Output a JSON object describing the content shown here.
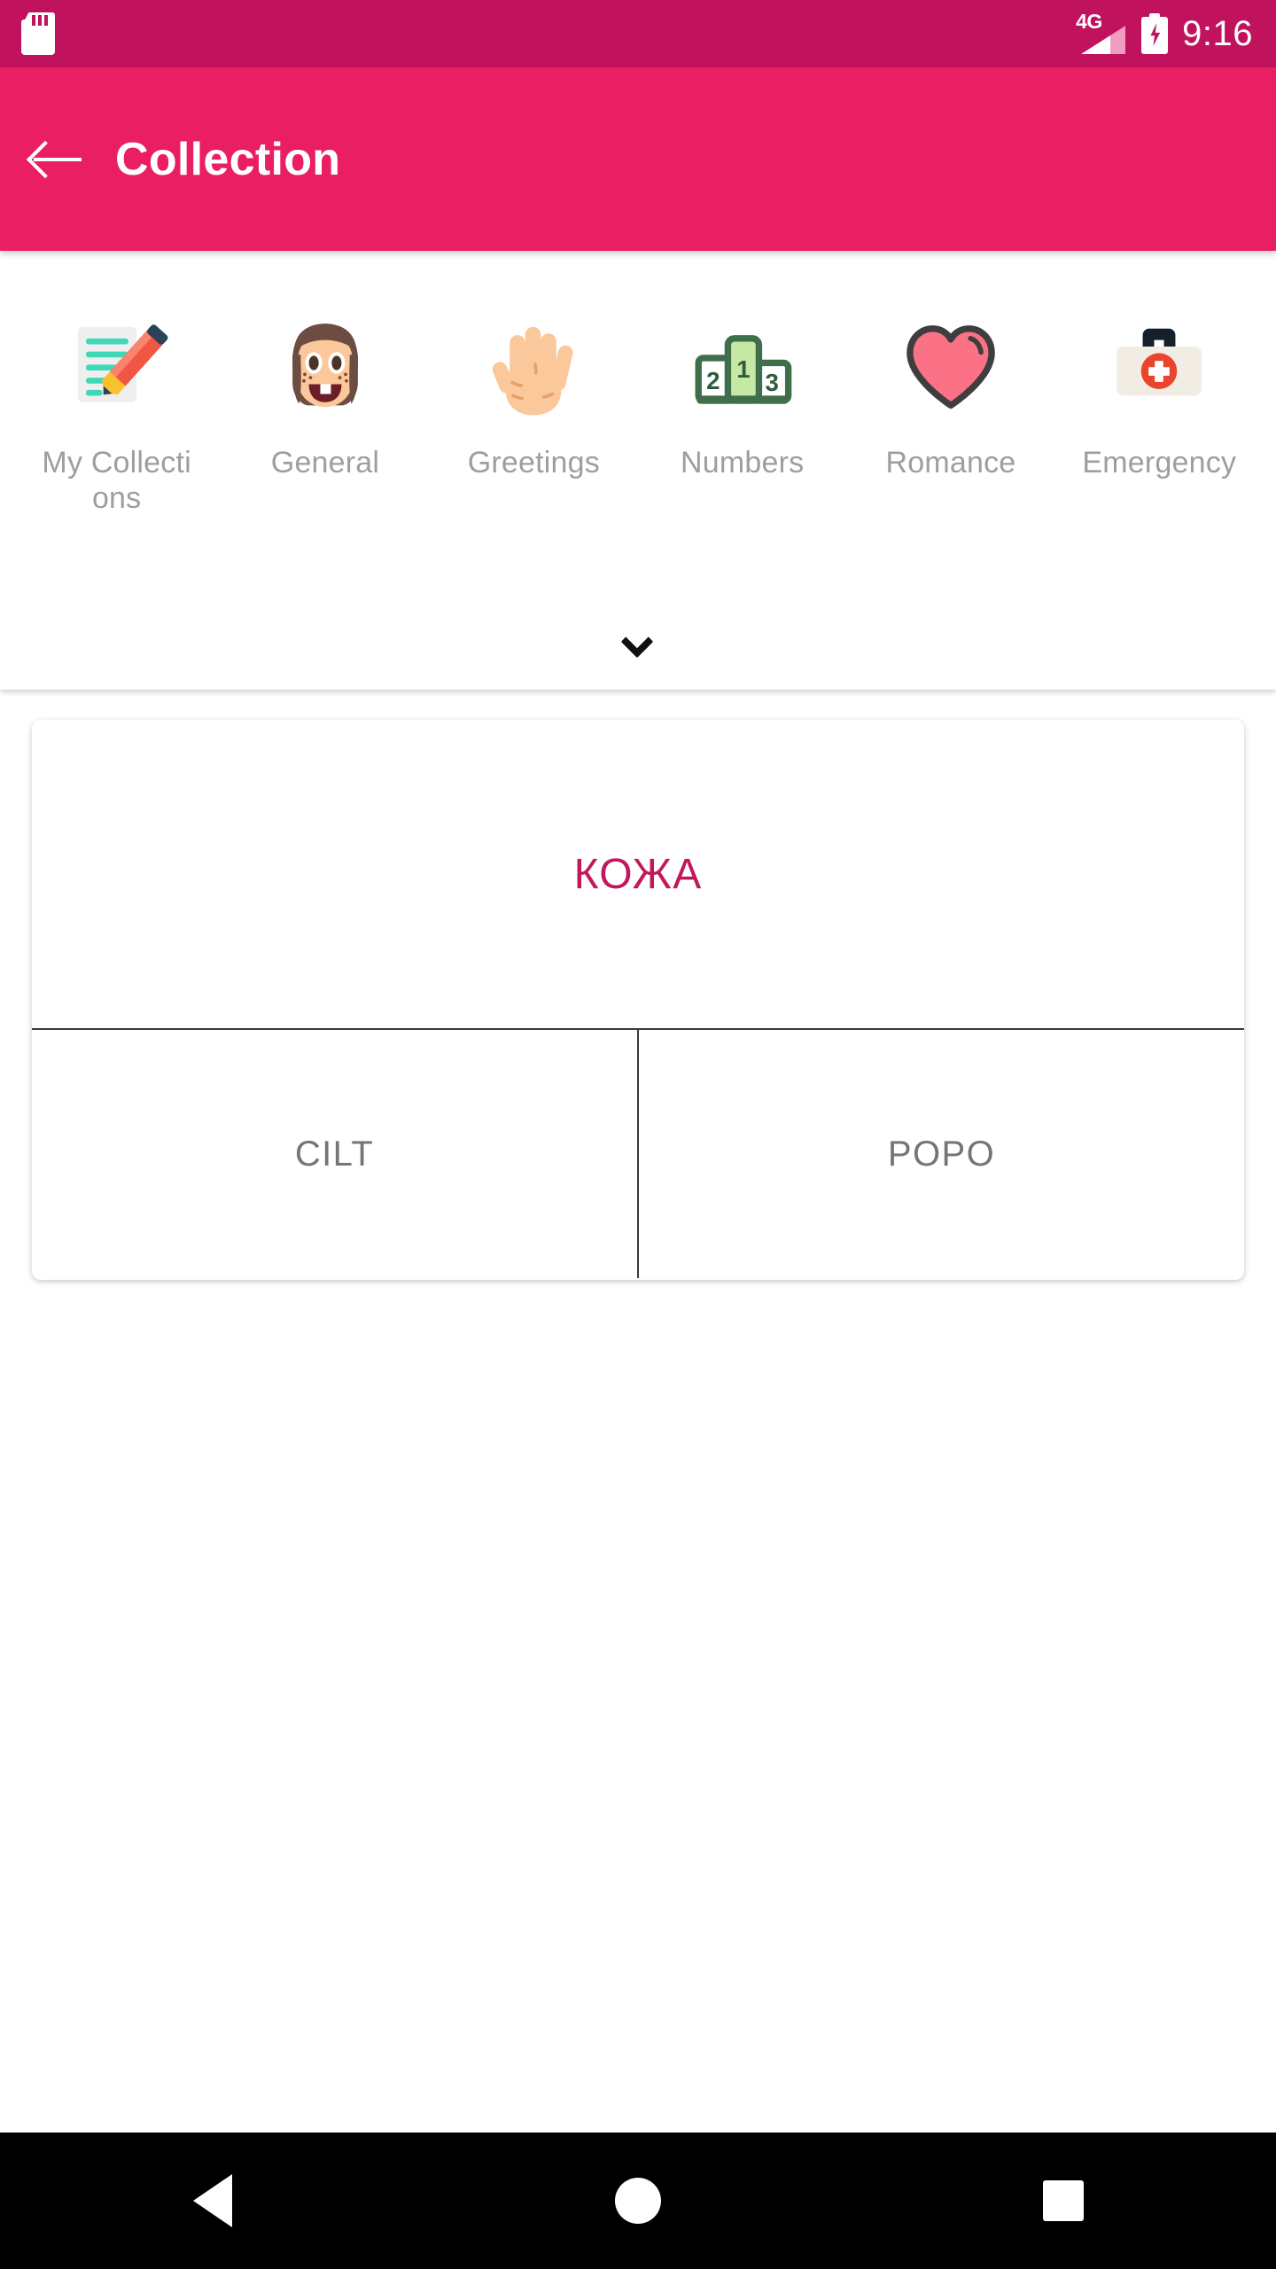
{
  "status_bar": {
    "sd_card_icon": "sd-card-icon",
    "network_type": "4G",
    "signal_icon": "signal-bars-icon",
    "battery_icon": "battery-charging-icon",
    "time": "9:16",
    "background_color": "#C0125D"
  },
  "app_bar": {
    "back_icon": "arrow-left-icon",
    "title": "Collection",
    "background_color": "#E91E63",
    "text_color": "#FFFFFF"
  },
  "categories": {
    "items": [
      {
        "label": "My Collections",
        "icon": "memo-pencil-icon"
      },
      {
        "label": "General",
        "icon": "girl-face-icon"
      },
      {
        "label": "Greetings",
        "icon": "raised-hand-icon"
      },
      {
        "label": "Numbers",
        "icon": "podium-icon"
      },
      {
        "label": "Romance",
        "icon": "heart-icon"
      },
      {
        "label": "Emergency",
        "icon": "first-aid-kit-icon"
      }
    ],
    "label_color": "#9E9E9E",
    "expand_icon": "chevron-down-icon"
  },
  "card": {
    "term": "КОЖА",
    "term_color": "#C2185B",
    "answers": [
      {
        "label": "CILT"
      },
      {
        "label": "POPO"
      }
    ],
    "answer_color": "#757575"
  },
  "nav_bar": {
    "back_icon": "nav-back-triangle-icon",
    "home_icon": "nav-home-circle-icon",
    "recents_icon": "nav-recents-square-icon",
    "background_color": "#000000"
  }
}
